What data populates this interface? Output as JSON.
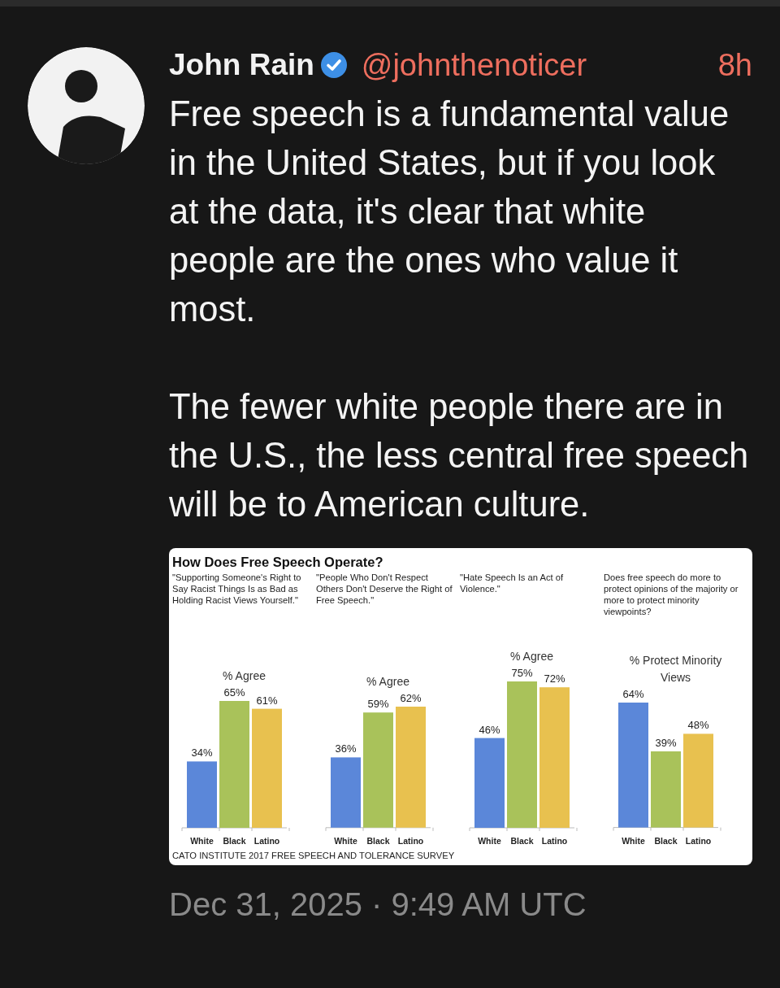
{
  "post": {
    "author": "John Rain",
    "verified": true,
    "handle": "@johnthenoticer",
    "age": "8h",
    "paragraphs": [
      "Free speech is a fundamental value in the United States, but if you look at the data, it's clear that white people are the ones who value it most.",
      "The fewer white people there are in the U.S., the less central free speech will be to American culture."
    ],
    "image": {
      "title": "How Does Free Speech Operate?",
      "charts": [
        {
          "chart_data": {
            "type": "bar",
            "title": "\"Supporting Someone's Right to Say Racist Things Is as Bad as Holding Racist Views Yourself.\"",
            "ylabel": "% Agree",
            "categories": [
              "White",
              "Black",
              "Latino"
            ],
            "values": [
              34,
              65,
              61
            ],
            "colors": [
              "#5b87d9",
              "#a9c25a",
              "#e8c14f"
            ],
            "value_labels": [
              "34%",
              "65%",
              "61%"
            ]
          }
        },
        {
          "chart_data": {
            "type": "bar",
            "title": "\"People Who Don't Respect Others Don't Deserve the Right of Free Speech.\"",
            "ylabel": "% Agree",
            "categories": [
              "White",
              "Black",
              "Latino"
            ],
            "values": [
              36,
              59,
              62
            ],
            "colors": [
              "#5b87d9",
              "#a9c25a",
              "#e8c14f"
            ],
            "value_labels": [
              "36%",
              "59%",
              "62%"
            ]
          }
        },
        {
          "chart_data": {
            "type": "bar",
            "title": "\"Hate Speech Is an Act of Violence.\"",
            "ylabel": "% Agree",
            "categories": [
              "White",
              "Black",
              "Latino"
            ],
            "values": [
              46,
              75,
              72
            ],
            "colors": [
              "#5b87d9",
              "#a9c25a",
              "#e8c14f"
            ],
            "value_labels": [
              "46%",
              "75%",
              "72%"
            ]
          }
        },
        {
          "chart_data": {
            "type": "bar",
            "title": "Does free speech do more to protect opinions of the majority or more to protect minority viewpoints?",
            "ylabel": "% Protect Minority Views",
            "categories": [
              "White",
              "Black",
              "Latino"
            ],
            "values": [
              64,
              39,
              48
            ],
            "colors": [
              "#5b87d9",
              "#a9c25a",
              "#e8c14f"
            ],
            "value_labels": [
              "64%",
              "39%",
              "48%"
            ]
          }
        }
      ],
      "source": "CATO INSTITUTE 2017 FREE SPEECH AND TOLERANCE SURVEY"
    },
    "timestamp": "Dec 31, 2025 · 9:49 AM UTC"
  }
}
